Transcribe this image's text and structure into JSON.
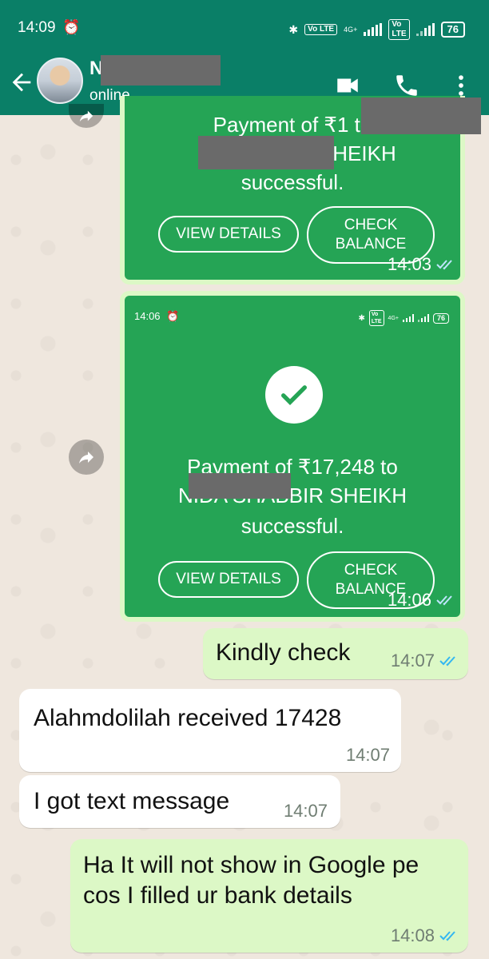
{
  "status_bar": {
    "time": "14:09",
    "alarm_icon": "alarm-clock-icon",
    "volte_label": "Vo LTE",
    "network_label": "4G+",
    "battery": "76"
  },
  "header": {
    "contact_initial": "N",
    "contact_status": "online"
  },
  "card1": {
    "line1": "Payment of ₹1 to",
    "line2": "HEIKH",
    "line3": "successful.",
    "view_details": "VIEW DETAILS",
    "check_balance": "CHECK BALANCE",
    "time": "14:03"
  },
  "card2": {
    "inner_time": "14:06",
    "inner_battery": "76",
    "inner_network": "4G+",
    "line1": "Payment of ₹17,248 to",
    "line2": "NIDA SHABBIR SHEIKH",
    "line3": "successful.",
    "view_details": "VIEW DETAILS",
    "check_balance": "CHECK BALANCE",
    "time": "14:06"
  },
  "messages": [
    {
      "text": "Kindly check",
      "time": "14:07"
    },
    {
      "text": "Alahmdolilah received 17428",
      "time": "14:07"
    },
    {
      "text": "I got text message",
      "time": "14:07"
    },
    {
      "text": "Ha It will not show in Google pe cos I filled ur bank details",
      "time": "14:08"
    }
  ],
  "colors": {
    "header": "#0a7f67",
    "payment_card": "#25a455",
    "outgoing_bubble": "#dcf8c6",
    "read_ticks": "#34b7f1"
  }
}
